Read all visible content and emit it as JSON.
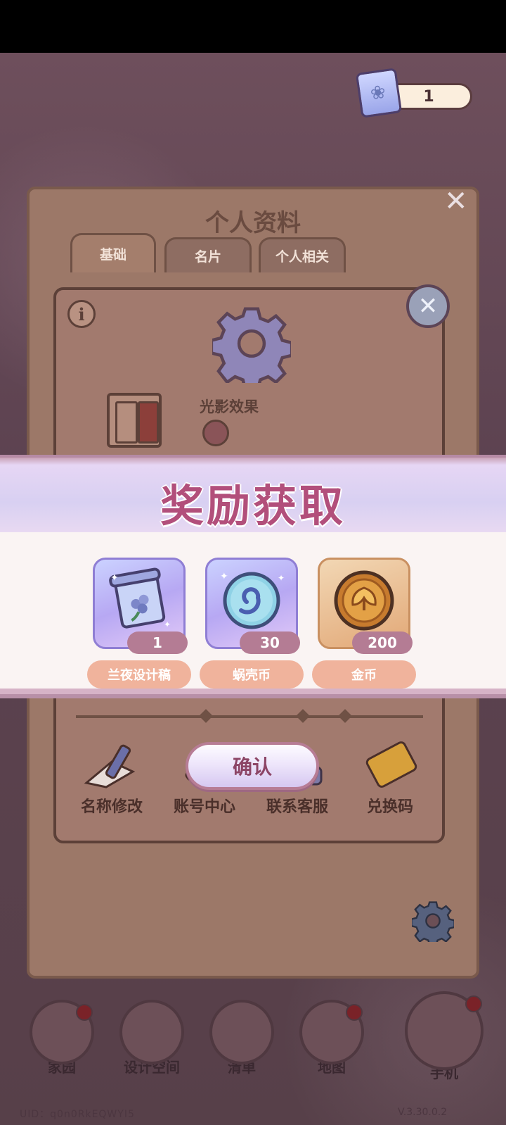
{
  "status_bar": {},
  "currency": {
    "amount": "1",
    "icon": "design-draft-icon"
  },
  "profile": {
    "title": "个人资料",
    "tabs": [
      "基础",
      "名片",
      "个人相关"
    ],
    "close_icon": "close-icon"
  },
  "settings": {
    "light_effect_label": "光影效果",
    "items": [
      {
        "label": "名称修改",
        "icon": "pencil-icon"
      },
      {
        "label": "账号中心",
        "icon": "key-icon"
      },
      {
        "label": "联系客服",
        "icon": "headset-icon"
      },
      {
        "label": "兑换码",
        "icon": "ticket-icon"
      }
    ]
  },
  "reward": {
    "title": "奖励获取",
    "items": [
      {
        "name": "兰夜设计稿",
        "count": "1",
        "icon": "design-draft-icon"
      },
      {
        "name": "蜗壳币",
        "count": "30",
        "icon": "snail-coin-icon"
      },
      {
        "name": "金币",
        "count": "200",
        "icon": "gold-coin-icon"
      }
    ],
    "confirm_label": "确认"
  },
  "bottom_nav": [
    {
      "label": "家园",
      "icon": "home-icon",
      "badge": true
    },
    {
      "label": "设计空间",
      "icon": "design-icon",
      "badge": false
    },
    {
      "label": "清单",
      "icon": "list-icon",
      "badge": false
    },
    {
      "label": "地图",
      "icon": "map-pin-icon",
      "badge": true
    },
    {
      "label": "手机",
      "icon": "phone-icon",
      "badge": true
    }
  ],
  "footer": {
    "id": "UID：q0n0RkEQWYI5",
    "version": "V.3.30.0.2"
  },
  "colors": {
    "reward_title": "#b24f7b",
    "count_pill": "#b47c94",
    "name_pill": "#f0b39c",
    "confirm_text": "#8c4566"
  }
}
